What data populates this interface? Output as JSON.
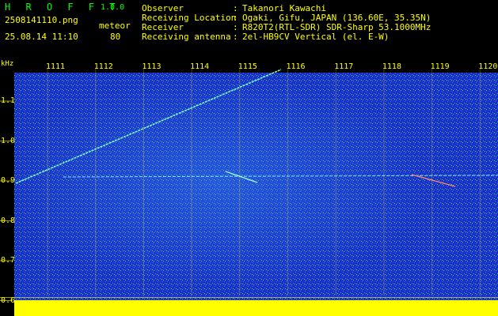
{
  "app": {
    "name": "H R O F F T",
    "version": "1.0.0"
  },
  "capture": {
    "filename": "2508141110.png",
    "datetime": "25.08.14 11:10",
    "mode_label": "meteor",
    "mode_value": "80"
  },
  "station": [
    {
      "key": "Observer",
      "value": "Takanori Kawachi"
    },
    {
      "key": "Receiving Location",
      "value": "Ogaki, Gifu, JAPAN (136.60E, 35.35N)"
    },
    {
      "key": "Receiver",
      "value": "R820T2(RTL-SDR) SDR-Sharp 53.1000MHz"
    },
    {
      "key": "Receiving antenna",
      "value": "2el-HB9CV Vertical (el. E-W)"
    }
  ],
  "separator": ":",
  "axes": {
    "unit": "kHz",
    "minute_ticks": [
      "1111",
      "1112",
      "1113",
      "1114",
      "1115",
      "1116",
      "1117",
      "1118",
      "1119",
      "1120"
    ],
    "freq_ticks": [
      "1.1",
      "1.0",
      "0.9",
      "0.8",
      "0.7",
      "0.6"
    ]
  },
  "colors": {
    "text": "#ffff00",
    "brand": "#00ff00",
    "background": "#1a2ec8",
    "trace": "#00ff80"
  }
}
